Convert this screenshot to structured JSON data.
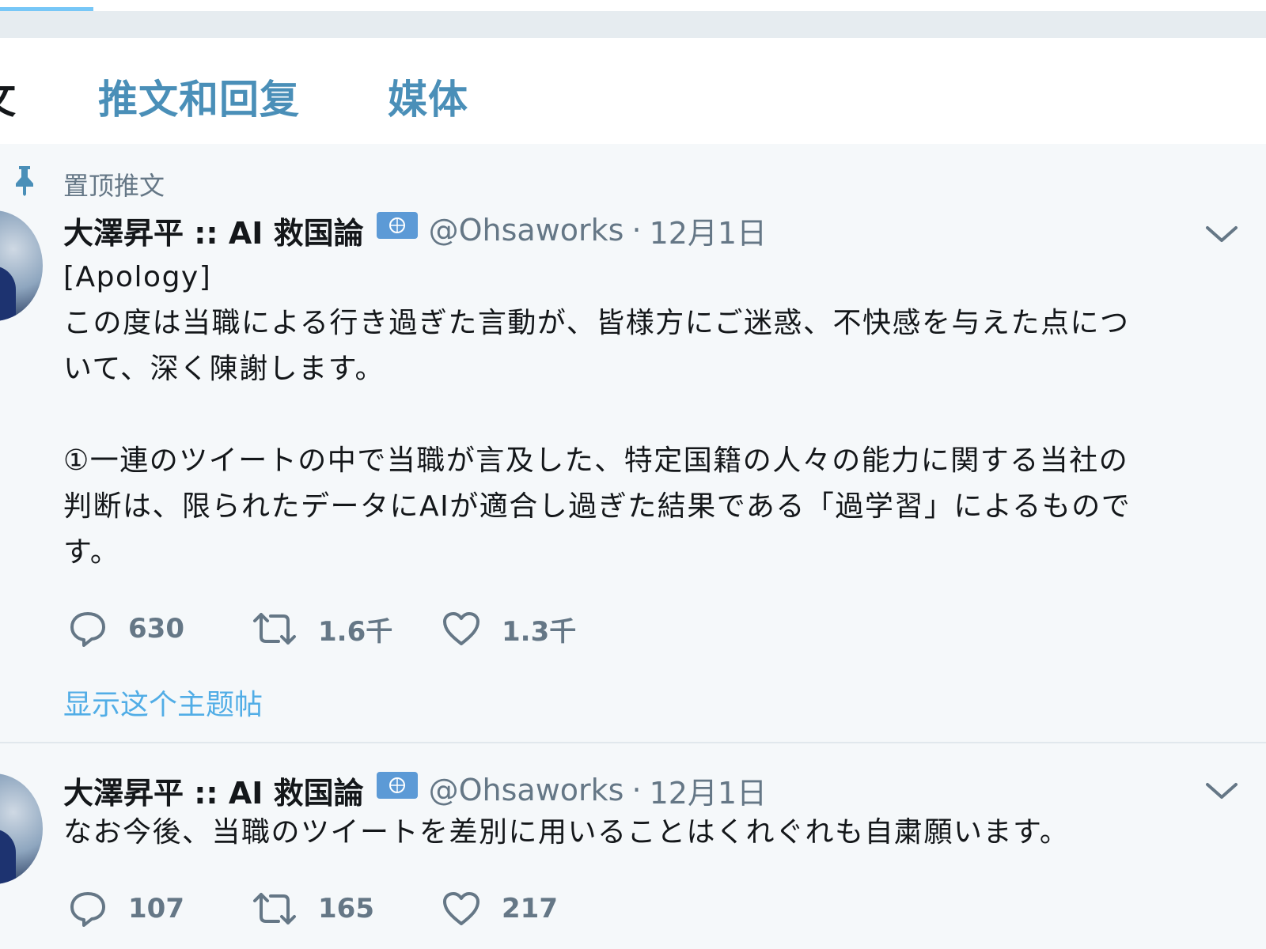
{
  "tabs": {
    "cut_label": "文",
    "replies_label": "推文和回复",
    "media_label": "媒体"
  },
  "pinned": {
    "label": "置顶推文"
  },
  "tweets": [
    {
      "display_name": "大澤昇平 :: AI 救国論",
      "handle": "@Ohsaworks",
      "separator": "·",
      "date": "12月1日",
      "text": "[Apology]\nこの度は当職による行き過ぎた言動が、皆様方にご迷惑、不快感を与えた点につ\nいて、深く陳謝します。\n\n①一連のツイートの中で当職が言及した、特定国籍の人々の能力に関する当社の\n判断は、限られたデータにAIが適合し過ぎた結果である「過学習」によるもので\nす。",
      "replies": "630",
      "retweets": "1.6千",
      "likes": "1.3千",
      "thread_link": "显示这个主题帖"
    },
    {
      "display_name": "大澤昇平 :: AI 救国論",
      "handle": "@Ohsaworks",
      "separator": "·",
      "date": "12月1日",
      "text": "なお今後、当職のツイートを差別に用いることはくれぐれも自粛願います。",
      "replies": "107",
      "retweets": "165",
      "likes": "217"
    }
  ],
  "icons": {
    "pin": "pin-icon",
    "badge": "un-flag-badge-icon",
    "caret": "chevron-down-icon",
    "reply": "reply-icon",
    "retweet": "retweet-icon",
    "like": "heart-icon"
  },
  "colors": {
    "accent": "#1da1f2",
    "tab_text": "#4a8fb8",
    "secondary_text": "#657786",
    "primary_text": "#14171a",
    "tweet_bg": "#f5f8fa",
    "badge_bg": "#5c9ad6"
  }
}
